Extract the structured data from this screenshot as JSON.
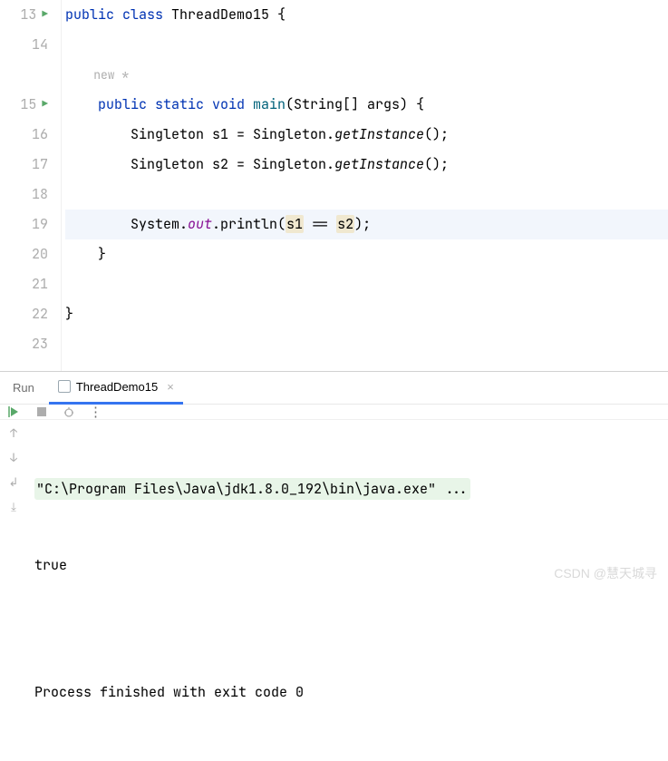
{
  "editor": {
    "lines": [
      {
        "num": "13",
        "runnable": true,
        "highlight": false,
        "segments": [
          {
            "t": "public ",
            "c": "kw"
          },
          {
            "t": "class ",
            "c": "kw"
          },
          {
            "t": "ThreadDemo15 {",
            "c": ""
          }
        ]
      },
      {
        "num": "14",
        "runnable": false,
        "highlight": false,
        "segments": []
      },
      {
        "num": "",
        "runnable": false,
        "highlight": false,
        "hint": "new *",
        "indent": "    "
      },
      {
        "num": "15",
        "runnable": true,
        "highlight": false,
        "segments": [
          {
            "t": "    ",
            "c": ""
          },
          {
            "t": "public static void ",
            "c": "kw"
          },
          {
            "t": "main",
            "c": "method-decl"
          },
          {
            "t": "(String[] args) {",
            "c": ""
          }
        ]
      },
      {
        "num": "16",
        "runnable": false,
        "highlight": false,
        "segments": [
          {
            "t": "        Singleton s1 = Singleton.",
            "c": ""
          },
          {
            "t": "getInstance",
            "c": "static-call"
          },
          {
            "t": "();",
            "c": ""
          }
        ]
      },
      {
        "num": "17",
        "runnable": false,
        "highlight": false,
        "segments": [
          {
            "t": "        Singleton s2 = Singleton.",
            "c": ""
          },
          {
            "t": "getInstance",
            "c": "static-call"
          },
          {
            "t": "();",
            "c": ""
          }
        ]
      },
      {
        "num": "18",
        "runnable": false,
        "highlight": false,
        "segments": []
      },
      {
        "num": "19",
        "runnable": false,
        "highlight": true,
        "segments": [
          {
            "t": "        System.",
            "c": ""
          },
          {
            "t": "out",
            "c": "static-field"
          },
          {
            "t": ".println(",
            "c": ""
          },
          {
            "t": "s1",
            "c": "var-hl"
          },
          {
            "t": " == ",
            "c": ""
          },
          {
            "t": "s2",
            "c": "var-hl"
          },
          {
            "t": ");",
            "c": ""
          }
        ]
      },
      {
        "num": "20",
        "runnable": false,
        "highlight": false,
        "segments": [
          {
            "t": "    }",
            "c": ""
          }
        ]
      },
      {
        "num": "21",
        "runnable": false,
        "highlight": false,
        "segments": []
      },
      {
        "num": "22",
        "runnable": false,
        "highlight": false,
        "segments": [
          {
            "t": "}",
            "c": ""
          }
        ]
      },
      {
        "num": "23",
        "runnable": false,
        "highlight": false,
        "segments": []
      }
    ]
  },
  "runPanel": {
    "label": "Run",
    "tabName": "ThreadDemo15",
    "console": {
      "cmd": "\"C:\\Program Files\\Java\\jdk1.8.0_192\\bin\\java.exe\" ...",
      "output": "true",
      "blank": "",
      "exit": "Process finished with exit code 0"
    }
  },
  "watermark": "CSDN @慧天城寻"
}
